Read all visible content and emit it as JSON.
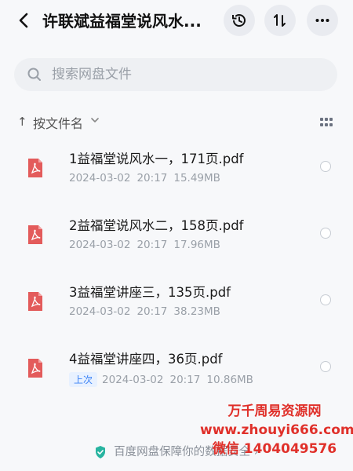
{
  "header": {
    "title": "许联斌益福堂说风水...",
    "back_icon": "chevron-left-icon",
    "history_icon": "history-icon",
    "sort_icon": "sort-toggle-icon",
    "more_icon": "more-horizontal-icon"
  },
  "search": {
    "placeholder": "搜索网盘文件"
  },
  "sort": {
    "arrow": "↑",
    "label": "按文件名"
  },
  "files": [
    {
      "name": "1益福堂说风水一，171页.pdf",
      "date": "2024-03-02",
      "time": "20:17",
      "size": "15.49MB",
      "badge": ""
    },
    {
      "name": "2益福堂说风水二，158页.pdf",
      "date": "2024-03-02",
      "time": "20:17",
      "size": "17.96MB",
      "badge": ""
    },
    {
      "name": "3益福堂讲座三，135页.pdf",
      "date": "2024-03-02",
      "time": "20:17",
      "size": "38.23MB",
      "badge": ""
    },
    {
      "name": "4益福堂讲座四，36页.pdf",
      "date": "2024-03-02",
      "time": "20:17",
      "size": "10.86MB",
      "badge": "上次"
    }
  ],
  "footer": {
    "guarantee_text": "百度网盘保障你的数据安全 ›"
  },
  "watermark": {
    "line1": "万千周易资源网",
    "line2": "www.zhouyi666.com",
    "line3": "微信 1404049576"
  },
  "colors": {
    "pdf_red": "#e35b5b",
    "badge_blue": "#3b82f6",
    "watermark_red": "#e0302a"
  }
}
